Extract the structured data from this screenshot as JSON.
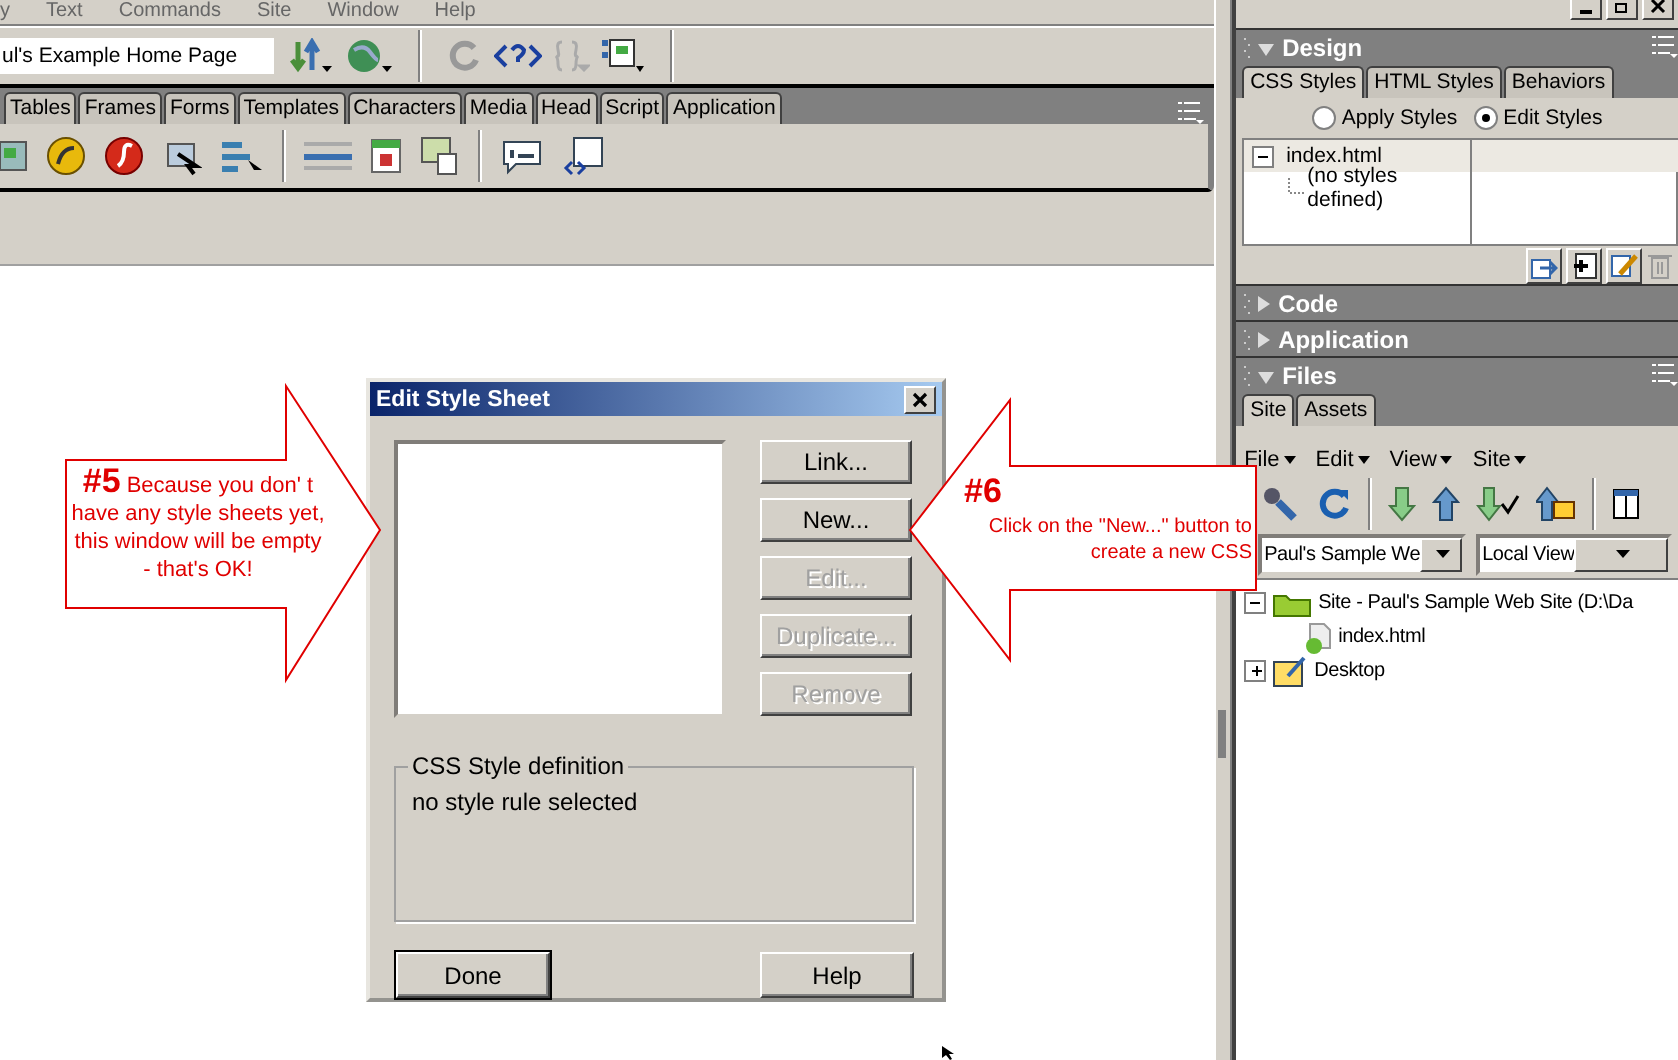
{
  "menu_bar": [
    "y",
    "Text",
    "Commands",
    "Site",
    "Window",
    "Help"
  ],
  "document_toolbar": {
    "title_field": "ul's Example Home Page"
  },
  "insert_bar": {
    "tabs": [
      {
        "label": "Tables",
        "selected": false
      },
      {
        "label": "Frames",
        "selected": false
      },
      {
        "label": "Forms",
        "selected": false
      },
      {
        "label": "Templates",
        "selected": false
      },
      {
        "label": "Characters",
        "selected": false
      },
      {
        "label": "Media",
        "selected": false
      },
      {
        "label": "Head",
        "selected": false
      },
      {
        "label": "Script",
        "selected": false
      },
      {
        "label": "Application",
        "selected": false
      }
    ]
  },
  "panel_groups": [
    {
      "title": "Design",
      "expanded": true
    },
    {
      "title": "Code",
      "expanded": false
    },
    {
      "title": "Application",
      "expanded": false
    },
    {
      "title": "Files",
      "expanded": true
    }
  ],
  "design_panel": {
    "tabs": [
      {
        "label": "CSS Styles",
        "selected": true
      },
      {
        "label": "HTML Styles",
        "selected": false
      },
      {
        "label": "Behaviors",
        "selected": false
      }
    ],
    "radios": [
      {
        "label": "Apply Styles",
        "selected": false
      },
      {
        "label": "Edit Styles",
        "selected": true
      }
    ],
    "tree": [
      {
        "label": "index.html",
        "expanded": true,
        "children": [
          {
            "label": "(no styles defined)"
          }
        ]
      }
    ]
  },
  "files_panel": {
    "tabs": [
      {
        "label": "Site",
        "selected": true
      },
      {
        "label": "Assets",
        "selected": false
      }
    ],
    "menus": [
      "File",
      "Edit",
      "View",
      "Site"
    ],
    "site_select": "Paul's Sample We",
    "view_select": "Local View",
    "tree": [
      {
        "label": "Site - Paul's Sample Web Site (D:\\Da",
        "kind": "folder",
        "expanded": true,
        "children": [
          {
            "label": "index.html",
            "kind": "file"
          }
        ]
      },
      {
        "label": "Desktop",
        "kind": "desktop",
        "expanded": false
      }
    ]
  },
  "dialog": {
    "title": "Edit Style Sheet",
    "buttons": [
      {
        "label": "Link...",
        "disabled": false
      },
      {
        "label": "New...",
        "disabled": false
      },
      {
        "label": "Edit...",
        "disabled": true
      },
      {
        "label": "Duplicate...",
        "disabled": true
      },
      {
        "label": "Remove",
        "disabled": true
      }
    ],
    "group_title": "CSS Style definition",
    "group_text": "no style rule selected",
    "footer_buttons": [
      {
        "label": "Done",
        "default": true
      },
      {
        "label": "Help",
        "default": false
      }
    ]
  },
  "callouts": [
    {
      "number": "#5",
      "text": "Because you don' t have any style sheets yet, this window will be empty - that's OK!"
    },
    {
      "number": "#6",
      "text": "Click on the \"New...\" button to create a new CSS"
    }
  ]
}
